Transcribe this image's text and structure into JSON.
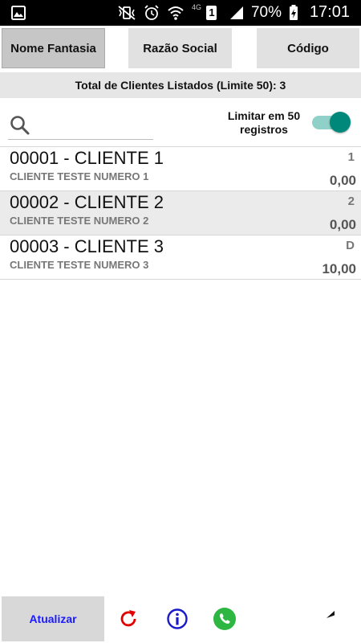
{
  "status_bar": {
    "battery_percent": "70%",
    "time": "17:01",
    "network": "4G",
    "sim": "1"
  },
  "tabs": [
    {
      "label": "Nome Fantasia",
      "active": true
    },
    {
      "label": "Razão Social",
      "active": false
    },
    {
      "label": "Código",
      "active": false
    }
  ],
  "summary": {
    "total_text": "Total de Clientes Listados (Limite 50): 3"
  },
  "search": {
    "placeholder": "",
    "value": ""
  },
  "limit_toggle": {
    "label": "Limitar em 50 registros",
    "enabled": true
  },
  "clients": [
    {
      "title": "00001 - CLIENTE 1",
      "subtitle": "CLIENTE TESTE NUMERO 1",
      "code": "1",
      "value": "0,00"
    },
    {
      "title": "00002 - CLIENTE 2",
      "subtitle": "CLIENTE TESTE NUMERO 2",
      "code": "2",
      "value": "0,00"
    },
    {
      "title": "00003 - CLIENTE 3",
      "subtitle": "CLIENTE TESTE NUMERO 3",
      "code": "D",
      "value": "10,00"
    }
  ],
  "bottom_bar": {
    "update_label": "Atualizar",
    "icons": [
      "refresh-icon",
      "info-icon",
      "whatsapp-icon",
      "back-icon"
    ]
  },
  "colors": {
    "accent_toggle": "#00897b",
    "update_text": "#1a1aff",
    "refresh": "#e00000",
    "info": "#1a1acc",
    "whatsapp": "#2db742"
  }
}
